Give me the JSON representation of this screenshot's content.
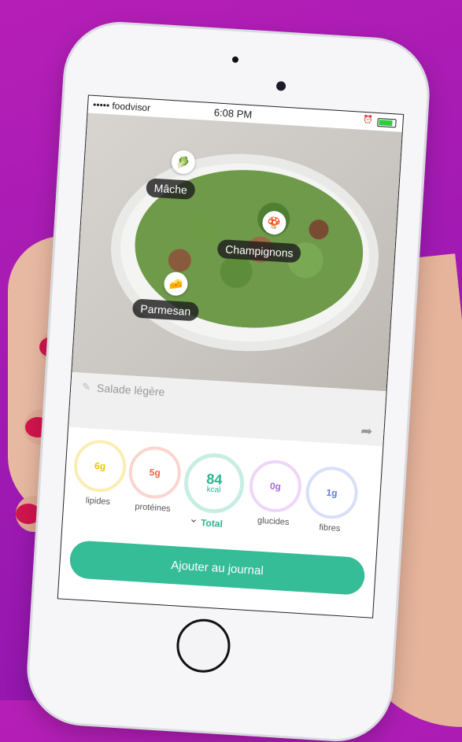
{
  "status_bar": {
    "carrier": "••••• foodvisor",
    "time": "6:08 PM"
  },
  "photo": {
    "tags": [
      {
        "label": "Mâche",
        "icon": "lettuce-icon"
      },
      {
        "label": "Champignons",
        "icon": "mushroom-icon"
      },
      {
        "label": "Parmesan",
        "icon": "cheese-icon"
      }
    ]
  },
  "meal": {
    "name_placeholder": "Salade légère"
  },
  "nutrients": [
    {
      "value": "6g",
      "label": "lipides",
      "color": "#f2c200"
    },
    {
      "value": "5g",
      "label": "protéines",
      "color": "#f0624d"
    },
    {
      "value": "84",
      "unit": "kcal",
      "label": "Total",
      "color": "#2bb48e"
    },
    {
      "value": "0g",
      "label": "glucides",
      "color": "#b065d6"
    },
    {
      "value": "1g",
      "label": "fibres",
      "color": "#5b7be0"
    }
  ],
  "actions": {
    "add_label": "Ajouter au journal"
  },
  "colors": {
    "background": "#a21ab3",
    "accent": "#34bd97"
  }
}
